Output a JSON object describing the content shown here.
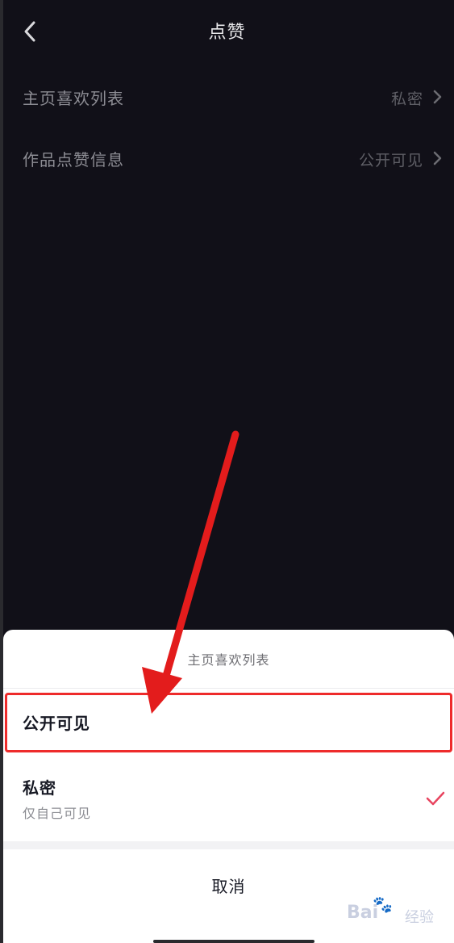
{
  "nav": {
    "title": "点赞",
    "back_icon": "chevron-left-icon"
  },
  "settings": [
    {
      "label": "主页喜欢列表",
      "value": "私密"
    },
    {
      "label": "作品点赞信息",
      "value": "公开可见"
    }
  ],
  "sheet": {
    "title": "主页喜欢列表",
    "options": [
      {
        "title": "公开可见",
        "subtitle": "",
        "selected": false
      },
      {
        "title": "私密",
        "subtitle": "仅自己可见",
        "selected": true
      }
    ],
    "cancel": "取消"
  },
  "watermark": {
    "brand": "Bai",
    "sub": "经验"
  },
  "colors": {
    "background": "#111018",
    "sheet": "#ffffff",
    "check": "#e8445f",
    "annotation_red": "#ee2b2b"
  }
}
